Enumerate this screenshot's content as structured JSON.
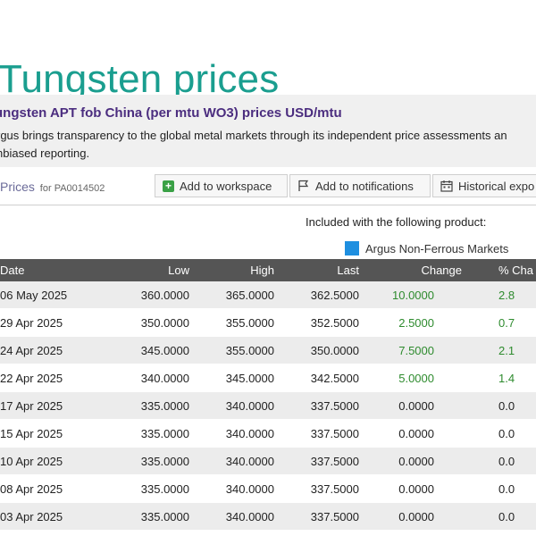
{
  "page": {
    "title": "Tungsten prices"
  },
  "product": {
    "title": "ungsten APT fob China (per mtu WO3) prices USD/mtu",
    "description_line1": "rgus brings transparency to the global metal markets through its independent price assessments an",
    "description_line2": "nbiased reporting."
  },
  "toolbar": {
    "prices_label": "Prices",
    "code_label": "for PA0014502",
    "workspace_label": "Add to workspace",
    "notify_label": "Add to notifications",
    "export_label": "Historical expo"
  },
  "included": {
    "text": "Included with the following product:",
    "product_name": "Argus Non-Ferrous Markets",
    "product_color": "#1e8fe0"
  },
  "table": {
    "headers": {
      "date": "Date",
      "low": "Low",
      "high": "High",
      "last": "Last",
      "change": "Change",
      "pct": "% Cha"
    },
    "rows": [
      {
        "date": "06 May 2025",
        "low": "360.0000",
        "high": "365.0000",
        "last": "362.5000",
        "change": "10.0000",
        "pct": "2.8"
      },
      {
        "date": "29 Apr 2025",
        "low": "350.0000",
        "high": "355.0000",
        "last": "352.5000",
        "change": "2.5000",
        "pct": "0.7"
      },
      {
        "date": "24 Apr 2025",
        "low": "345.0000",
        "high": "355.0000",
        "last": "350.0000",
        "change": "7.5000",
        "pct": "2.1"
      },
      {
        "date": "22 Apr 2025",
        "low": "340.0000",
        "high": "345.0000",
        "last": "342.5000",
        "change": "5.0000",
        "pct": "1.4"
      },
      {
        "date": "17 Apr 2025",
        "low": "335.0000",
        "high": "340.0000",
        "last": "337.5000",
        "change": "0.0000",
        "pct": "0.0"
      },
      {
        "date": "15 Apr 2025",
        "low": "335.0000",
        "high": "340.0000",
        "last": "337.5000",
        "change": "0.0000",
        "pct": "0.0"
      },
      {
        "date": "10 Apr 2025",
        "low": "335.0000",
        "high": "340.0000",
        "last": "337.5000",
        "change": "0.0000",
        "pct": "0.0"
      },
      {
        "date": "08 Apr 2025",
        "low": "335.0000",
        "high": "340.0000",
        "last": "337.5000",
        "change": "0.0000",
        "pct": "0.0"
      },
      {
        "date": "03 Apr 2025",
        "low": "335.0000",
        "high": "340.0000",
        "last": "337.5000",
        "change": "0.0000",
        "pct": "0.0"
      }
    ]
  },
  "colors": {
    "title": "#1a9e8f",
    "positive": "#2e8b2e",
    "header_bg": "#555555"
  }
}
